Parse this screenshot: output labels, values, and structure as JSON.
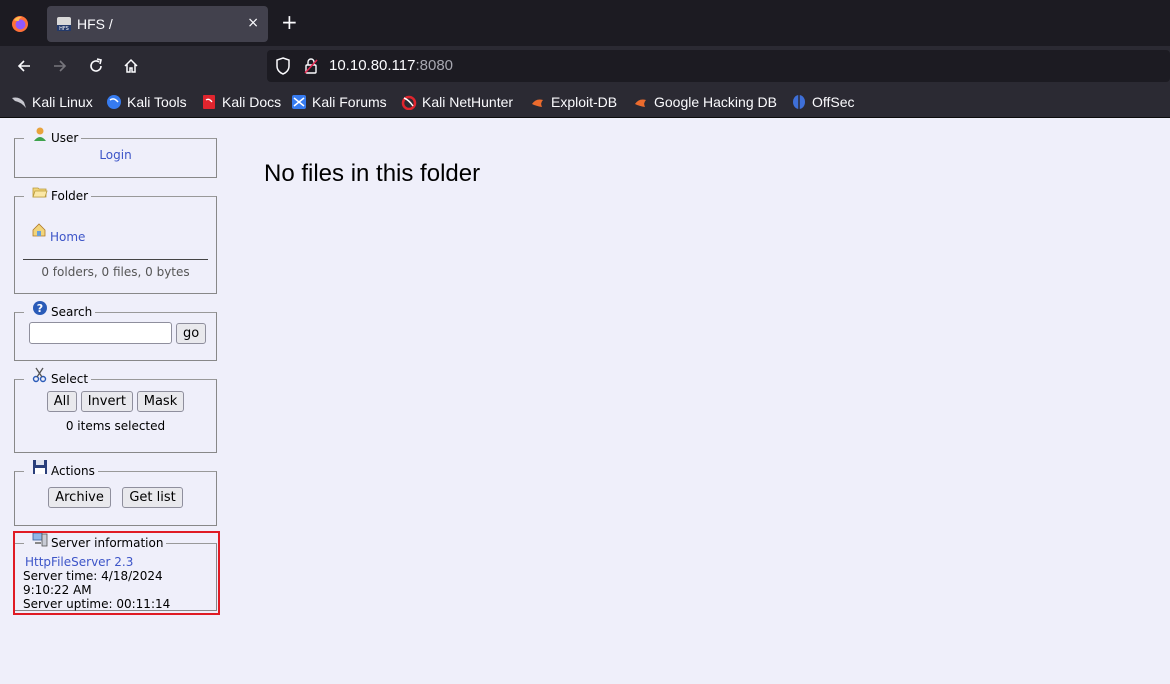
{
  "browser": {
    "tab_title": "HFS /",
    "tab_close": "×",
    "new_tab": "+",
    "url_host": "10.10.80.117",
    "url_port": ":8080",
    "bookmarks": [
      {
        "label": "Kali Linux",
        "icon": "kali-linux-icon"
      },
      {
        "label": "Kali Tools",
        "icon": "kali-tools-icon"
      },
      {
        "label": "Kali Docs",
        "icon": "kali-docs-icon"
      },
      {
        "label": "Kali Forums",
        "icon": "kali-forums-icon"
      },
      {
        "label": "Kali NetHunter",
        "icon": "kali-nethunter-icon"
      },
      {
        "label": "Exploit-DB",
        "icon": "exploit-db-icon"
      },
      {
        "label": "Google Hacking DB",
        "icon": "google-hacking-db-icon"
      },
      {
        "label": "OffSec",
        "icon": "offsec-icon"
      }
    ]
  },
  "sidebar": {
    "user": {
      "legend": "User",
      "login_label": "Login"
    },
    "folder": {
      "legend": "Folder",
      "home_label": "Home",
      "stats": "0 folders, 0 files, 0 bytes"
    },
    "search": {
      "legend": "Search",
      "input_value": "",
      "go_label": "go"
    },
    "select": {
      "legend": "Select",
      "all_label": "All",
      "invert_label": "Invert",
      "mask_label": "Mask",
      "status": "0 items selected"
    },
    "actions": {
      "legend": "Actions",
      "archive_label": "Archive",
      "getlist_label": "Get list"
    },
    "server": {
      "legend": "Server information",
      "version_link": "HttpFileServer 2.3",
      "time": "Server time: 4/18/2024 9:10:22 AM",
      "uptime": "Server uptime: 00:11:14"
    }
  },
  "main": {
    "message": "No files in this folder"
  },
  "colors": {
    "highlight": "#e01b24",
    "link": "#3d55c8",
    "page_bg": "#efeffa"
  }
}
